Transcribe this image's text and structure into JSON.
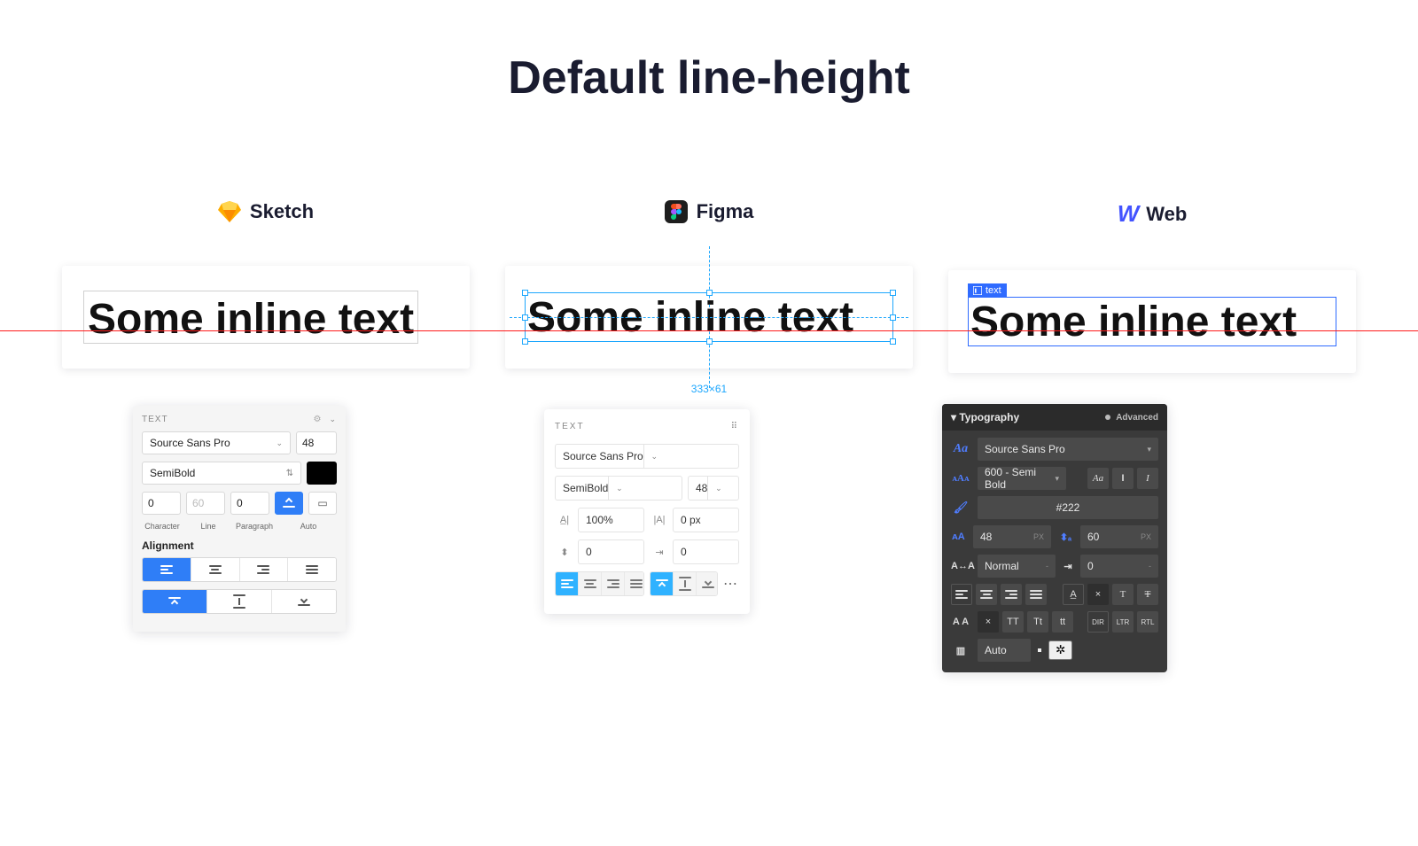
{
  "title": "Default line-height",
  "tools": {
    "sketch": "Sketch",
    "figma": "Figma",
    "web": "Web"
  },
  "sample_text": "Some inline text",
  "figma_preview": {
    "dims": "333×61"
  },
  "web_preview": {
    "badge": "text"
  },
  "sketch_panel": {
    "header": "TEXT",
    "font": "Source Sans Pro",
    "size": "48",
    "weight": "SemiBold",
    "char": "0",
    "line": "60",
    "para": "0",
    "labels": {
      "char": "Character",
      "line": "Line",
      "para": "Paragraph",
      "auto": "Auto"
    },
    "alignment_label": "Alignment"
  },
  "figma_panel": {
    "header": "TEXT",
    "font": "Source Sans Pro",
    "weight": "SemiBold",
    "size": "48",
    "lineheight": "100%",
    "letter": "0 px",
    "para_spacing": "0",
    "para_indent": "0"
  },
  "web_panel": {
    "header": "Typography",
    "advanced": "Advanced",
    "font": "Source Sans Pro",
    "weight": "600 - Semi Bold",
    "color": "#222",
    "size": "48",
    "lineheight": "60",
    "px": "PX",
    "letter": "Normal",
    "indent": "0",
    "dash": "-",
    "x": "×",
    "caps": {
      "tt_upper": "TT",
      "tt_cap": "Tt",
      "tt_lower": "tt"
    },
    "dir": {
      "dir": "DIR",
      "ltr": "LTR",
      "rtl": "RTL"
    },
    "auto": "Auto"
  }
}
